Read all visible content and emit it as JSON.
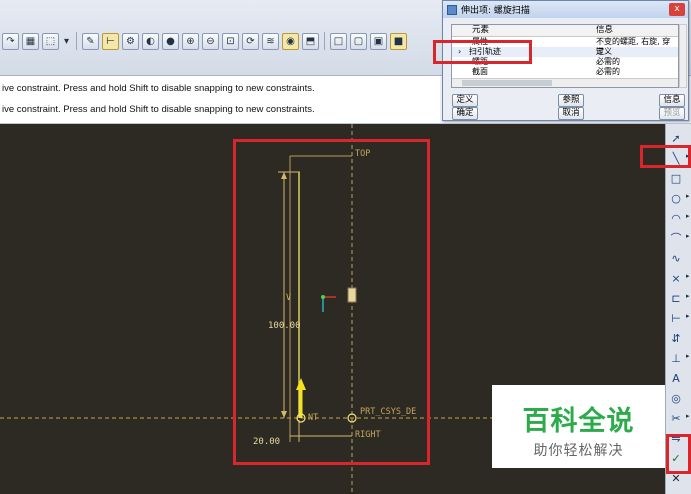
{
  "toolbar": {
    "icons": [
      "redo-icon",
      "grid-icon",
      "select-box-icon",
      "dropdown-icon",
      "sketch-icon",
      "constraints-icon",
      "relations-icon",
      "display-style-icon",
      "sphere-icon",
      "zoom-in-icon",
      "zoom-out-icon",
      "zoom-fit-icon",
      "repaint-icon",
      "layers-icon",
      "view-icon",
      "orient-icon",
      "wireframe-icon",
      "hidden-line-icon",
      "no-hidden-icon",
      "shaded-icon"
    ]
  },
  "messages": {
    "line1": "ive constraint. Press and hold Shift to disable snapping to new constraints.",
    "line2": "ive constraint. Press and hold Shift to disable snapping to new constraints."
  },
  "dialog": {
    "title": "伸出项: 螺旋扫描",
    "close_label": "x",
    "columns": {
      "element": "元素",
      "info": "信息"
    },
    "rows": [
      {
        "element": "属性",
        "info": "不变的螺距, 右旋,  穿过"
      },
      {
        "element": "扫引轨迹",
        "info": "定义"
      },
      {
        "element": "螺距",
        "info": "必需的"
      },
      {
        "element": "截面",
        "info": "必需的"
      }
    ],
    "buttons": {
      "define": "定义",
      "reference": "参照",
      "info": "信息",
      "ok": "确定",
      "cancel": "取消",
      "preview": "预览"
    }
  },
  "sketch": {
    "top_label": "TOP",
    "right_label": "RIGHT",
    "csys_label": "PRT_CSYS_DE",
    "pnt_label": "NT",
    "v_label": "V",
    "dim_height": "100.00",
    "dim_width": "20.00"
  },
  "sidebar": {
    "icons": [
      "select-arrow-icon",
      "line-icon",
      "rectangle-icon",
      "circle-icon",
      "arc-icon",
      "fillet-icon",
      "spline-icon",
      "point-icon",
      "csys-icon",
      "offset-edge-icon",
      "dimension-icon",
      "modify-icon",
      "constraint-icon",
      "text-icon",
      "palette-icon",
      "trim-icon",
      "mirror-icon",
      "accept-check-icon",
      "cancel-x-icon"
    ]
  },
  "watermark": {
    "title": "百科全说",
    "subtitle": "助你轻松解决"
  },
  "colors": {
    "canvas": "#2c2a22",
    "sketch_line": "#d4b86a",
    "highlight_red": "#d8262c",
    "watermark_green": "#2bab4a",
    "arrow_yellow": "#f5e21b"
  }
}
